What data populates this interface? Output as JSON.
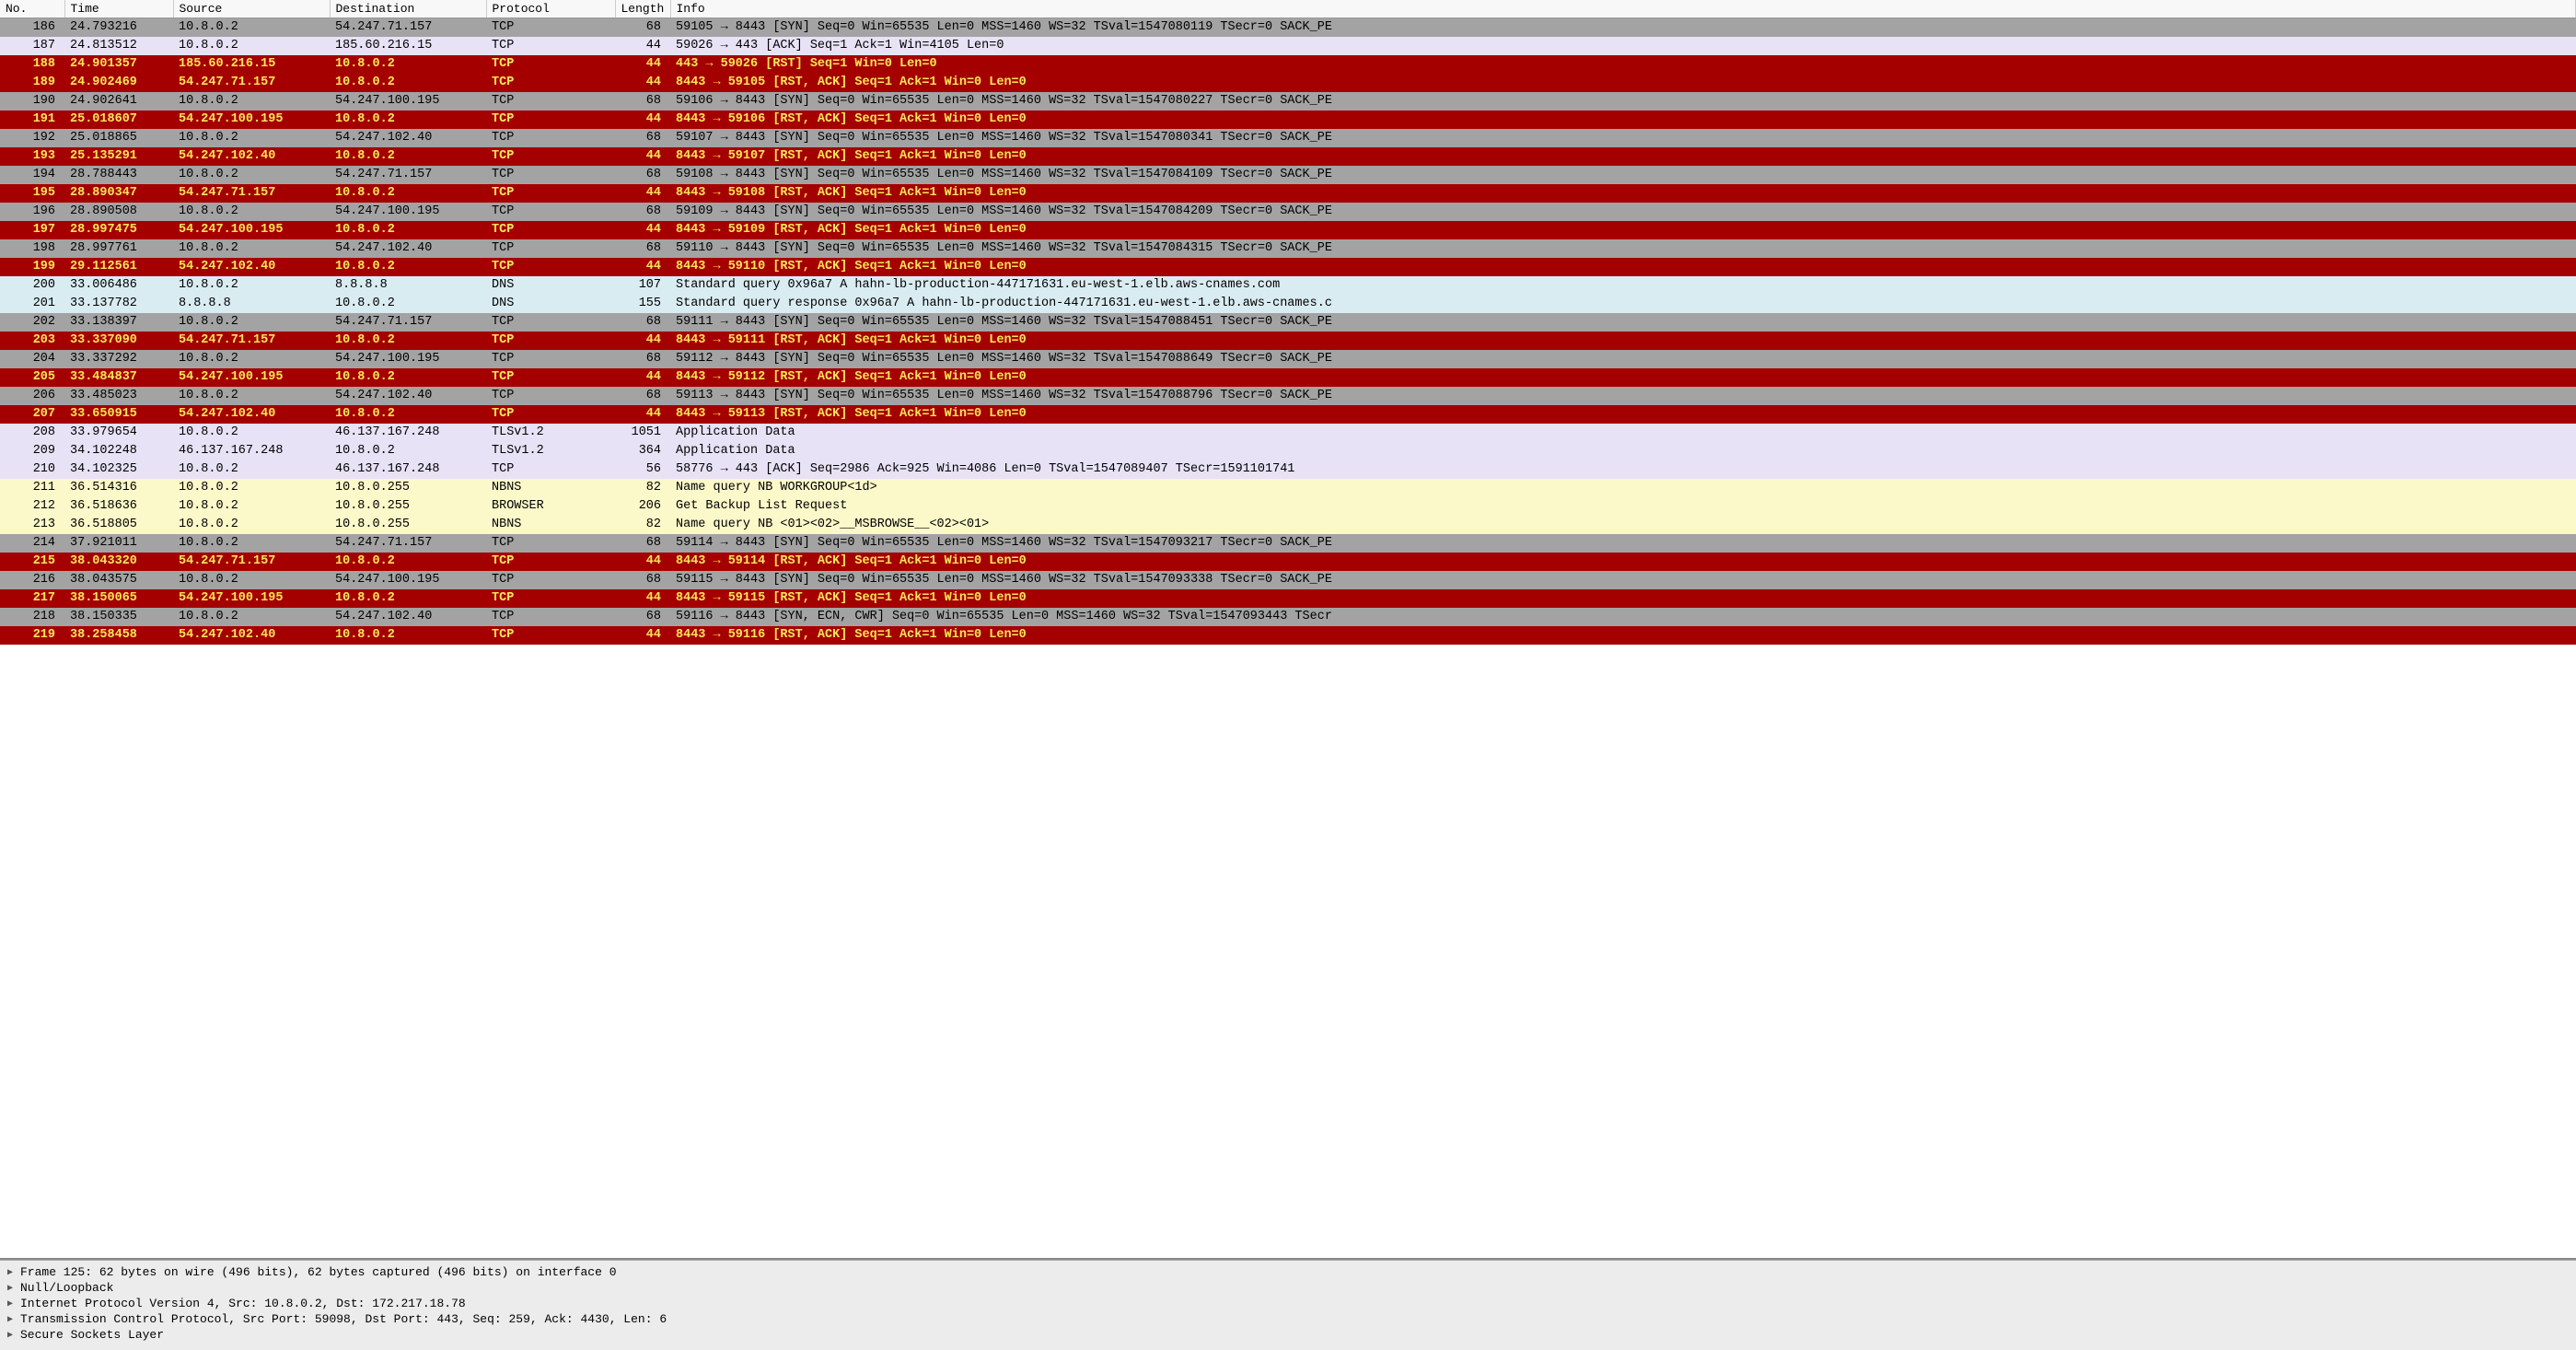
{
  "columns": [
    "No.",
    "Time",
    "Source",
    "Destination",
    "Protocol",
    "Length",
    "Info"
  ],
  "rows": [
    {
      "style": "r-gray",
      "no": 186,
      "time": "24.793216",
      "src": "10.8.0.2",
      "dst": "54.247.71.157",
      "proto": "TCP",
      "len": 68,
      "info": "59105 → 8443 [SYN] Seq=0 Win=65535 Len=0 MSS=1460 WS=32 TSval=1547080119 TSecr=0 SACK_PE"
    },
    {
      "style": "r-lav",
      "no": 187,
      "time": "24.813512",
      "src": "10.8.0.2",
      "dst": "185.60.216.15",
      "proto": "TCP",
      "len": 44,
      "info": "59026 → 443 [ACK] Seq=1 Ack=1 Win=4105 Len=0"
    },
    {
      "style": "r-red",
      "no": 188,
      "time": "24.901357",
      "src": "185.60.216.15",
      "dst": "10.8.0.2",
      "proto": "TCP",
      "len": 44,
      "info": "443 → 59026 [RST] Seq=1 Win=0 Len=0"
    },
    {
      "style": "r-red",
      "no": 189,
      "time": "24.902469",
      "src": "54.247.71.157",
      "dst": "10.8.0.2",
      "proto": "TCP",
      "len": 44,
      "info": "8443 → 59105 [RST, ACK] Seq=1 Ack=1 Win=0 Len=0"
    },
    {
      "style": "r-gray",
      "no": 190,
      "time": "24.902641",
      "src": "10.8.0.2",
      "dst": "54.247.100.195",
      "proto": "TCP",
      "len": 68,
      "info": "59106 → 8443 [SYN] Seq=0 Win=65535 Len=0 MSS=1460 WS=32 TSval=1547080227 TSecr=0 SACK_PE"
    },
    {
      "style": "r-red",
      "no": 191,
      "time": "25.018607",
      "src": "54.247.100.195",
      "dst": "10.8.0.2",
      "proto": "TCP",
      "len": 44,
      "info": "8443 → 59106 [RST, ACK] Seq=1 Ack=1 Win=0 Len=0"
    },
    {
      "style": "r-gray",
      "no": 192,
      "time": "25.018865",
      "src": "10.8.0.2",
      "dst": "54.247.102.40",
      "proto": "TCP",
      "len": 68,
      "info": "59107 → 8443 [SYN] Seq=0 Win=65535 Len=0 MSS=1460 WS=32 TSval=1547080341 TSecr=0 SACK_PE"
    },
    {
      "style": "r-red",
      "no": 193,
      "time": "25.135291",
      "src": "54.247.102.40",
      "dst": "10.8.0.2",
      "proto": "TCP",
      "len": 44,
      "info": "8443 → 59107 [RST, ACK] Seq=1 Ack=1 Win=0 Len=0"
    },
    {
      "style": "r-gray",
      "no": 194,
      "time": "28.788443",
      "src": "10.8.0.2",
      "dst": "54.247.71.157",
      "proto": "TCP",
      "len": 68,
      "info": "59108 → 8443 [SYN] Seq=0 Win=65535 Len=0 MSS=1460 WS=32 TSval=1547084109 TSecr=0 SACK_PE"
    },
    {
      "style": "r-red",
      "no": 195,
      "time": "28.890347",
      "src": "54.247.71.157",
      "dst": "10.8.0.2",
      "proto": "TCP",
      "len": 44,
      "info": "8443 → 59108 [RST, ACK] Seq=1 Ack=1 Win=0 Len=0"
    },
    {
      "style": "r-gray",
      "no": 196,
      "time": "28.890508",
      "src": "10.8.0.2",
      "dst": "54.247.100.195",
      "proto": "TCP",
      "len": 68,
      "info": "59109 → 8443 [SYN] Seq=0 Win=65535 Len=0 MSS=1460 WS=32 TSval=1547084209 TSecr=0 SACK_PE"
    },
    {
      "style": "r-red",
      "no": 197,
      "time": "28.997475",
      "src": "54.247.100.195",
      "dst": "10.8.0.2",
      "proto": "TCP",
      "len": 44,
      "info": "8443 → 59109 [RST, ACK] Seq=1 Ack=1 Win=0 Len=0"
    },
    {
      "style": "r-gray",
      "no": 198,
      "time": "28.997761",
      "src": "10.8.0.2",
      "dst": "54.247.102.40",
      "proto": "TCP",
      "len": 68,
      "info": "59110 → 8443 [SYN] Seq=0 Win=65535 Len=0 MSS=1460 WS=32 TSval=1547084315 TSecr=0 SACK_PE"
    },
    {
      "style": "r-red",
      "no": 199,
      "time": "29.112561",
      "src": "54.247.102.40",
      "dst": "10.8.0.2",
      "proto": "TCP",
      "len": 44,
      "info": "8443 → 59110 [RST, ACK] Seq=1 Ack=1 Win=0 Len=0"
    },
    {
      "style": "r-dns",
      "no": 200,
      "time": "33.006486",
      "src": "10.8.0.2",
      "dst": "8.8.8.8",
      "proto": "DNS",
      "len": 107,
      "info": "Standard query 0x96a7 A hahn-lb-production-447171631.eu-west-1.elb.aws-cnames.com"
    },
    {
      "style": "r-dns",
      "no": 201,
      "time": "33.137782",
      "src": "8.8.8.8",
      "dst": "10.8.0.2",
      "proto": "DNS",
      "len": 155,
      "info": "Standard query response 0x96a7 A hahn-lb-production-447171631.eu-west-1.elb.aws-cnames.c"
    },
    {
      "style": "r-gray",
      "no": 202,
      "time": "33.138397",
      "src": "10.8.0.2",
      "dst": "54.247.71.157",
      "proto": "TCP",
      "len": 68,
      "info": "59111 → 8443 [SYN] Seq=0 Win=65535 Len=0 MSS=1460 WS=32 TSval=1547088451 TSecr=0 SACK_PE"
    },
    {
      "style": "r-red",
      "no": 203,
      "time": "33.337090",
      "src": "54.247.71.157",
      "dst": "10.8.0.2",
      "proto": "TCP",
      "len": 44,
      "info": "8443 → 59111 [RST, ACK] Seq=1 Ack=1 Win=0 Len=0"
    },
    {
      "style": "r-gray",
      "no": 204,
      "time": "33.337292",
      "src": "10.8.0.2",
      "dst": "54.247.100.195",
      "proto": "TCP",
      "len": 68,
      "info": "59112 → 8443 [SYN] Seq=0 Win=65535 Len=0 MSS=1460 WS=32 TSval=1547088649 TSecr=0 SACK_PE"
    },
    {
      "style": "r-red",
      "no": 205,
      "time": "33.484837",
      "src": "54.247.100.195",
      "dst": "10.8.0.2",
      "proto": "TCP",
      "len": 44,
      "info": "8443 → 59112 [RST, ACK] Seq=1 Ack=1 Win=0 Len=0"
    },
    {
      "style": "r-gray",
      "no": 206,
      "time": "33.485023",
      "src": "10.8.0.2",
      "dst": "54.247.102.40",
      "proto": "TCP",
      "len": 68,
      "info": "59113 → 8443 [SYN] Seq=0 Win=65535 Len=0 MSS=1460 WS=32 TSval=1547088796 TSecr=0 SACK_PE"
    },
    {
      "style": "r-red",
      "no": 207,
      "time": "33.650915",
      "src": "54.247.102.40",
      "dst": "10.8.0.2",
      "proto": "TCP",
      "len": 44,
      "info": "8443 → 59113 [RST, ACK] Seq=1 Ack=1 Win=0 Len=0"
    },
    {
      "style": "r-lav",
      "no": 208,
      "time": "33.979654",
      "src": "10.8.0.2",
      "dst": "46.137.167.248",
      "proto": "TLSv1.2",
      "len": 1051,
      "info": "Application Data"
    },
    {
      "style": "r-lav",
      "no": 209,
      "time": "34.102248",
      "src": "46.137.167.248",
      "dst": "10.8.0.2",
      "proto": "TLSv1.2",
      "len": 364,
      "info": "Application Data"
    },
    {
      "style": "r-lav",
      "no": 210,
      "time": "34.102325",
      "src": "10.8.0.2",
      "dst": "46.137.167.248",
      "proto": "TCP",
      "len": 56,
      "info": "58776 → 443 [ACK] Seq=2986 Ack=925 Win=4086 Len=0 TSval=1547089407 TSecr=1591101741"
    },
    {
      "style": "r-paleY",
      "no": 211,
      "time": "36.514316",
      "src": "10.8.0.2",
      "dst": "10.8.0.255",
      "proto": "NBNS",
      "len": 82,
      "info": "Name query NB WORKGROUP<1d>"
    },
    {
      "style": "r-paleY",
      "no": 212,
      "time": "36.518636",
      "src": "10.8.0.2",
      "dst": "10.8.0.255",
      "proto": "BROWSER",
      "len": 206,
      "info": "Get Backup List Request"
    },
    {
      "style": "r-paleY",
      "no": 213,
      "time": "36.518805",
      "src": "10.8.0.2",
      "dst": "10.8.0.255",
      "proto": "NBNS",
      "len": 82,
      "info": "Name query NB <01><02>__MSBROWSE__<02><01>"
    },
    {
      "style": "r-gray",
      "no": 214,
      "time": "37.921011",
      "src": "10.8.0.2",
      "dst": "54.247.71.157",
      "proto": "TCP",
      "len": 68,
      "info": "59114 → 8443 [SYN] Seq=0 Win=65535 Len=0 MSS=1460 WS=32 TSval=1547093217 TSecr=0 SACK_PE"
    },
    {
      "style": "r-red",
      "no": 215,
      "time": "38.043320",
      "src": "54.247.71.157",
      "dst": "10.8.0.2",
      "proto": "TCP",
      "len": 44,
      "info": "8443 → 59114 [RST, ACK] Seq=1 Ack=1 Win=0 Len=0"
    },
    {
      "style": "r-gray",
      "no": 216,
      "time": "38.043575",
      "src": "10.8.0.2",
      "dst": "54.247.100.195",
      "proto": "TCP",
      "len": 68,
      "info": "59115 → 8443 [SYN] Seq=0 Win=65535 Len=0 MSS=1460 WS=32 TSval=1547093338 TSecr=0 SACK_PE"
    },
    {
      "style": "r-red",
      "no": 217,
      "time": "38.150065",
      "src": "54.247.100.195",
      "dst": "10.8.0.2",
      "proto": "TCP",
      "len": 44,
      "info": "8443 → 59115 [RST, ACK] Seq=1 Ack=1 Win=0 Len=0"
    },
    {
      "style": "r-gray",
      "no": 218,
      "time": "38.150335",
      "src": "10.8.0.2",
      "dst": "54.247.102.40",
      "proto": "TCP",
      "len": 68,
      "info": "59116 → 8443 [SYN, ECN, CWR] Seq=0 Win=65535 Len=0 MSS=1460 WS=32 TSval=1547093443 TSecr"
    },
    {
      "style": "r-red",
      "no": 219,
      "time": "38.258458",
      "src": "54.247.102.40",
      "dst": "10.8.0.2",
      "proto": "TCP",
      "len": 44,
      "info": "8443 → 59116 [RST, ACK] Seq=1 Ack=1 Win=0 Len=0"
    }
  ],
  "details": [
    "Frame 125: 62 bytes on wire (496 bits), 62 bytes captured (496 bits) on interface 0",
    "Null/Loopback",
    "Internet Protocol Version 4, Src: 10.8.0.2, Dst: 172.217.18.78",
    "Transmission Control Protocol, Src Port: 59098, Dst Port: 443, Seq: 259, Ack: 4430, Len: 6",
    "Secure Sockets Layer"
  ]
}
